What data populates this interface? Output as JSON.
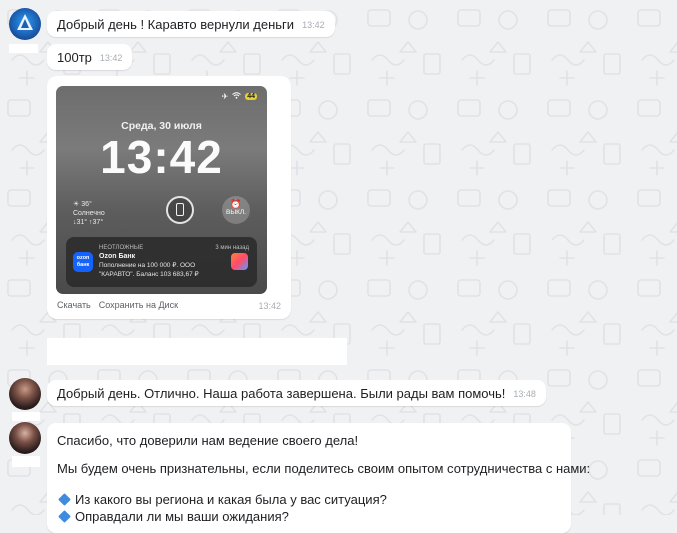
{
  "messages": [
    {
      "text": "Добрый день ! Каравто вернули деньги",
      "time": "13:42"
    },
    {
      "text": "100тр",
      "time": "13:42"
    }
  ],
  "photo": {
    "time": "13:42",
    "actions": [
      "Скачать",
      "Сохранить на Диск"
    ],
    "lockscreen": {
      "status_battery": "44",
      "date": "Среда, 30 июля",
      "clock": "13:42",
      "weather": {
        "temp": "36°",
        "condition": "Солнечно",
        "range": "↓31° ↑37°"
      },
      "alarm_label": "ВЫКЛ.",
      "notification": {
        "category": "НЕОТЛОЖНЫЕ",
        "ago": "3 мин назад",
        "title": "Ozon Банк",
        "line1": "Пополнение на 100 000 ₽. ООО",
        "line2": "\"КАРАВТО\". Баланс 103 683,67 ₽",
        "logo_text": "ozon банк"
      }
    }
  },
  "reply": {
    "text": "Добрый день. Отлично. Наша работа завершена. Были рады вам помочь!",
    "time": "13:48"
  },
  "long_message": {
    "line1": "Спасибо, что доверили нам ведение своего дела!",
    "line2": "Мы будем очень признательны, если поделитесь своим опытом сотрудничества с нами:",
    "q1": "Из какого вы региона и какая была у вас ситуация?",
    "q2": "Оправдали ли мы ваши ожидания?"
  },
  "colors": {
    "background": "#f0f1f3",
    "bubble": "#ffffff",
    "accent_blue": "#3e8be0",
    "ozon": "#1463ff"
  }
}
